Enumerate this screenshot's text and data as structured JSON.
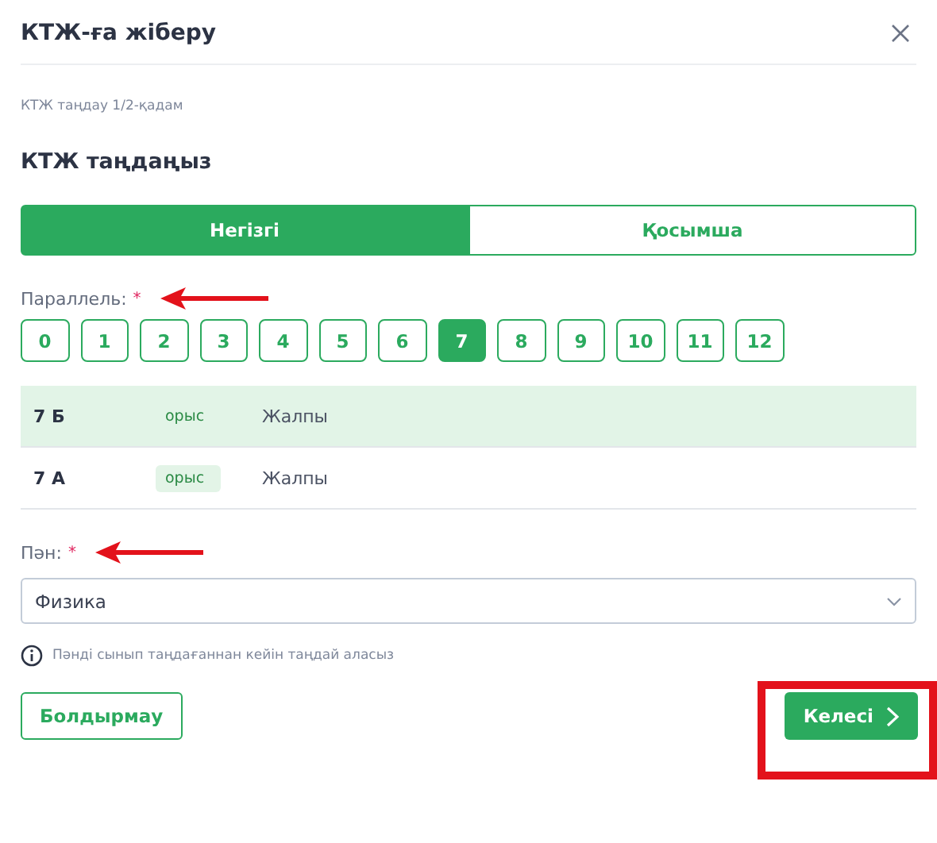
{
  "dialog": {
    "title": "КТЖ-ға жіберу"
  },
  "step": "КТЖ таңдау 1/2-қадам",
  "heading": "КТЖ таңдаңыз",
  "tabs": [
    {
      "label": "Негізгі",
      "selected": true
    },
    {
      "label": "Қосымша",
      "selected": false
    }
  ],
  "parallel": {
    "label": "Параллель:",
    "required": "*",
    "options": [
      {
        "label": "0",
        "selected": false
      },
      {
        "label": "1",
        "selected": false
      },
      {
        "label": "2",
        "selected": false
      },
      {
        "label": "3",
        "selected": false
      },
      {
        "label": "4",
        "selected": false
      },
      {
        "label": "5",
        "selected": false
      },
      {
        "label": "6",
        "selected": false
      },
      {
        "label": "7",
        "selected": true
      },
      {
        "label": "8",
        "selected": false
      },
      {
        "label": "9",
        "selected": false
      },
      {
        "label": "10",
        "selected": false
      },
      {
        "label": "11",
        "selected": false
      },
      {
        "label": "12",
        "selected": false
      }
    ]
  },
  "classes": [
    {
      "name": "7 Б",
      "language": "орыс",
      "type": "Жалпы",
      "selected": true
    },
    {
      "name": "7 А",
      "language": "орыс",
      "type": "Жалпы",
      "selected": false
    }
  ],
  "subject": {
    "label": "Пән:",
    "required": "*",
    "value": "Физика"
  },
  "hint": "Пәнді сынып таңдағаннан кейін таңдай аласыз",
  "buttons": {
    "cancel": "Болдырмау",
    "next": "Келесі"
  }
}
